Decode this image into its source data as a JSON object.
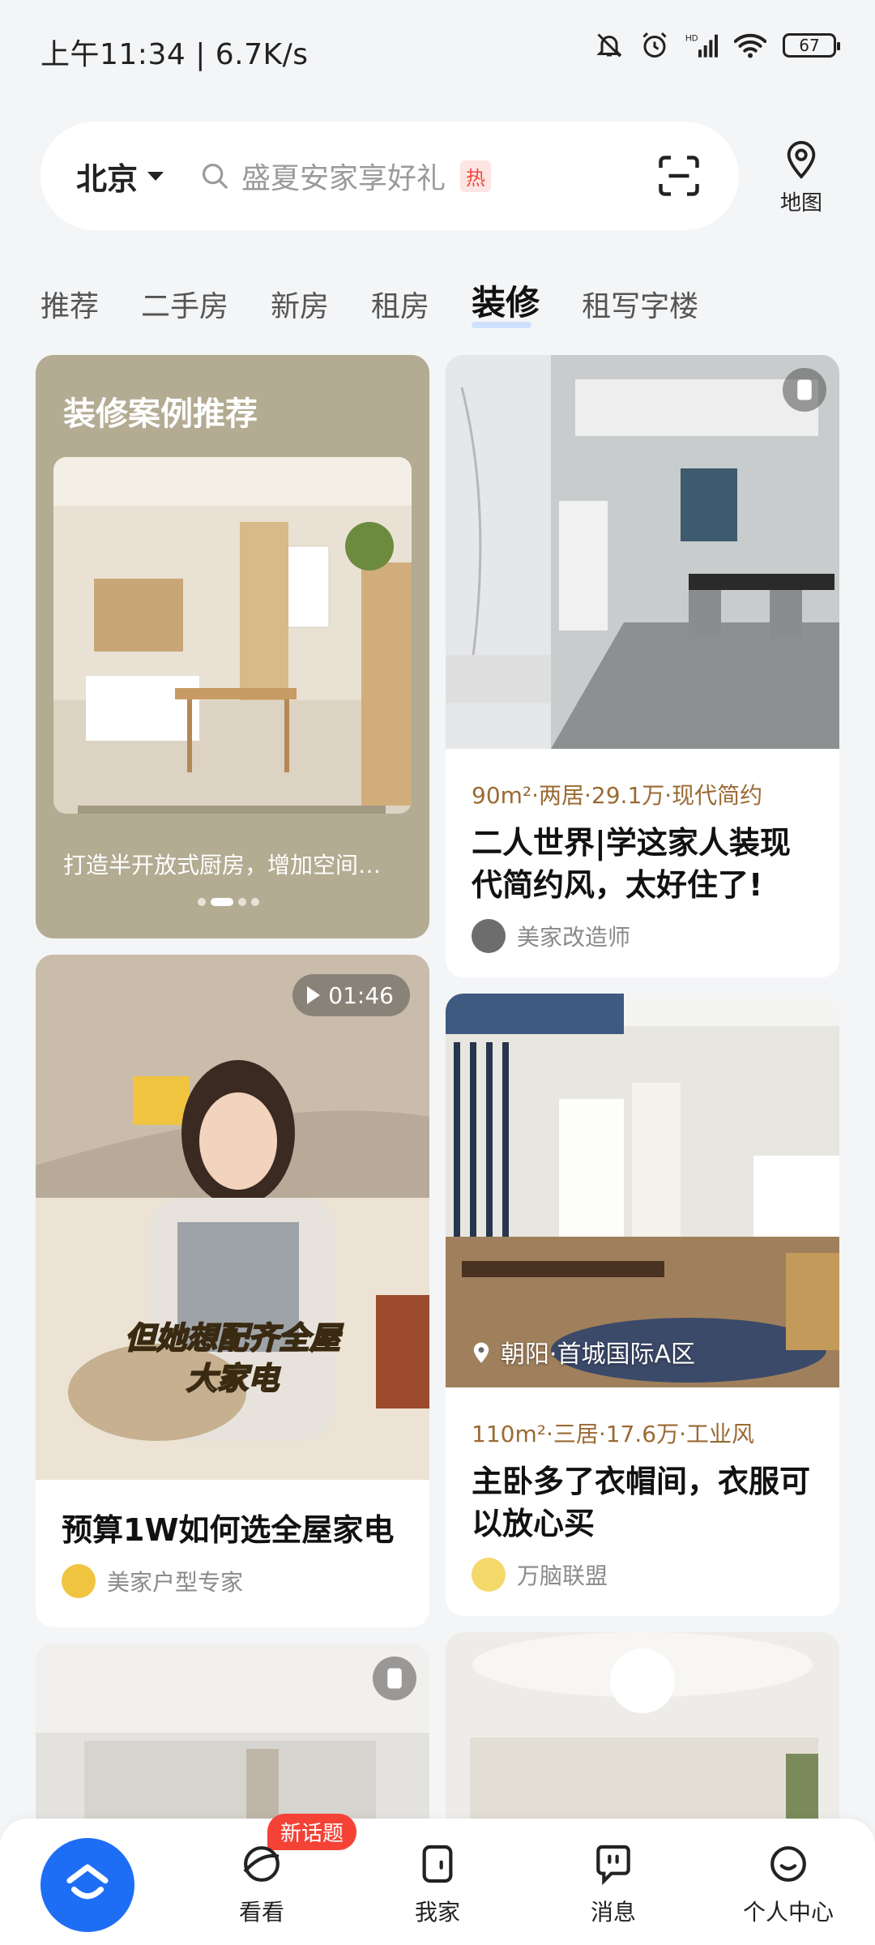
{
  "status_bar": {
    "time": "上午11:34",
    "speed": "6.7K/s",
    "battery": "67"
  },
  "search": {
    "city": "北京",
    "placeholder": "盛夏安家享好礼",
    "hot_badge": "热",
    "map_label": "地图"
  },
  "tabs": [
    {
      "label": "推荐",
      "active": false
    },
    {
      "label": "二手房",
      "active": false
    },
    {
      "label": "新房",
      "active": false
    },
    {
      "label": "租房",
      "active": false
    },
    {
      "label": "装修",
      "active": true
    },
    {
      "label": "租写字楼",
      "active": false
    }
  ],
  "feed": {
    "featured": {
      "title": "装修案例推荐",
      "caption": "打造半开放式厨房，增加空间…"
    },
    "cards": [
      {
        "meta": "90m²·两居·29.1万·现代简约",
        "title": "二人世界|学这家人装现代简约风，太好住了!",
        "author": "美家改造师"
      },
      {
        "duration": "01:46",
        "video_overlay_line1": "但她想配齐全屋",
        "video_overlay_line2": "大家电",
        "title": "预算1W如何选全屋家电",
        "author": "美家户型专家"
      },
      {
        "location": "朝阳·首城国际A区",
        "meta": "110m²·三居·17.6万·工业风",
        "title": "主卧多了衣帽间，衣服可以放心买",
        "author": "万脑联盟"
      }
    ]
  },
  "bottom_nav": {
    "items": [
      {
        "label": "看看",
        "icon": "explore-icon"
      },
      {
        "label": "我家",
        "icon": "home-door-icon"
      },
      {
        "label": "消息",
        "icon": "message-icon"
      },
      {
        "label": "个人中心",
        "icon": "profile-icon"
      }
    ],
    "new_badge": "新话题"
  },
  "colors": {
    "accent": "#1e6ef5",
    "meta_brown": "#9a6a33",
    "badge_red": "#f44336"
  }
}
